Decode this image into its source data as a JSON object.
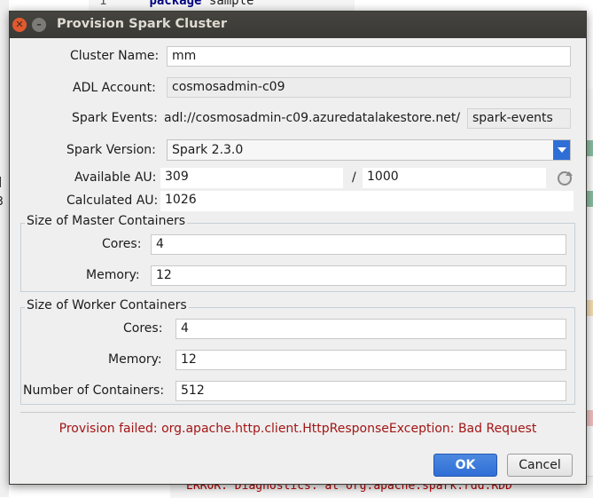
{
  "background": {
    "code_line_number": "1",
    "code_keyword": "package",
    "code_text": "sample",
    "left_fragment_1": "]",
    "left_fragment_2": "3",
    "error_line": "ERROR: Diagnostics:    at org.apache.spark.rdd.RDD"
  },
  "dialog": {
    "title": "Provision Spark Cluster",
    "cluster_name": {
      "label": "Cluster Name:",
      "value": "mm"
    },
    "adl_account": {
      "label": "ADL Account:",
      "value": "cosmosadmin-c09"
    },
    "spark_events": {
      "label": "Spark Events:",
      "prefix": "adl://cosmosadmin-c09.azuredatalakestore.net/",
      "value": "spark-events"
    },
    "spark_version": {
      "label": "Spark Version:",
      "value": "Spark 2.3.0"
    },
    "available_au": {
      "label": "Available AU:",
      "value": "309",
      "separator": "/",
      "total": "1000"
    },
    "calculated_au": {
      "label": "Calculated AU:",
      "value": "1026"
    },
    "master": {
      "title": "Size of Master Containers",
      "cores_label": "Cores:",
      "cores": "4",
      "memory_label": "Memory:",
      "memory": "12"
    },
    "worker": {
      "title": "Size of Worker Containers",
      "cores_label": "Cores:",
      "cores": "4",
      "memory_label": "Memory:",
      "memory": "12",
      "containers_label": "Number of Containers:",
      "containers": "512"
    },
    "error": "Provision failed: org.apache.http.client.HttpResponseException: Bad Request",
    "ok_label": "OK",
    "cancel_label": "Cancel"
  },
  "colors": {
    "titlebar": "#3a3935",
    "accent": "#2f6ed6",
    "error": "#a31515",
    "dialog_bg": "#efefef"
  }
}
